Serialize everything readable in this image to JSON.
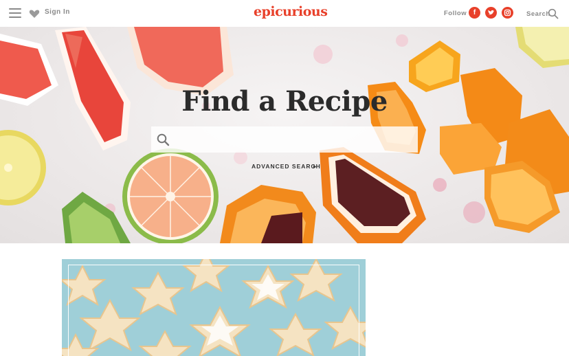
{
  "header": {
    "menu_icon": "hamburger-icon",
    "favorites_icon": "heart-icon",
    "signin_label": "Sign In",
    "logo_text": "epicurious",
    "follow_label": "Follow",
    "social": [
      {
        "name": "facebook",
        "glyph": "f"
      },
      {
        "name": "twitter",
        "glyph": "t"
      },
      {
        "name": "instagram",
        "glyph": "◎"
      }
    ],
    "search_label": "Search",
    "search_icon": "search-icon",
    "brand_color": "#e8402a"
  },
  "hero": {
    "title": "Find a Recipe",
    "search_placeholder": "",
    "advanced_search_label": "ADVANCED SEARCH",
    "advanced_chevron": "▸"
  }
}
